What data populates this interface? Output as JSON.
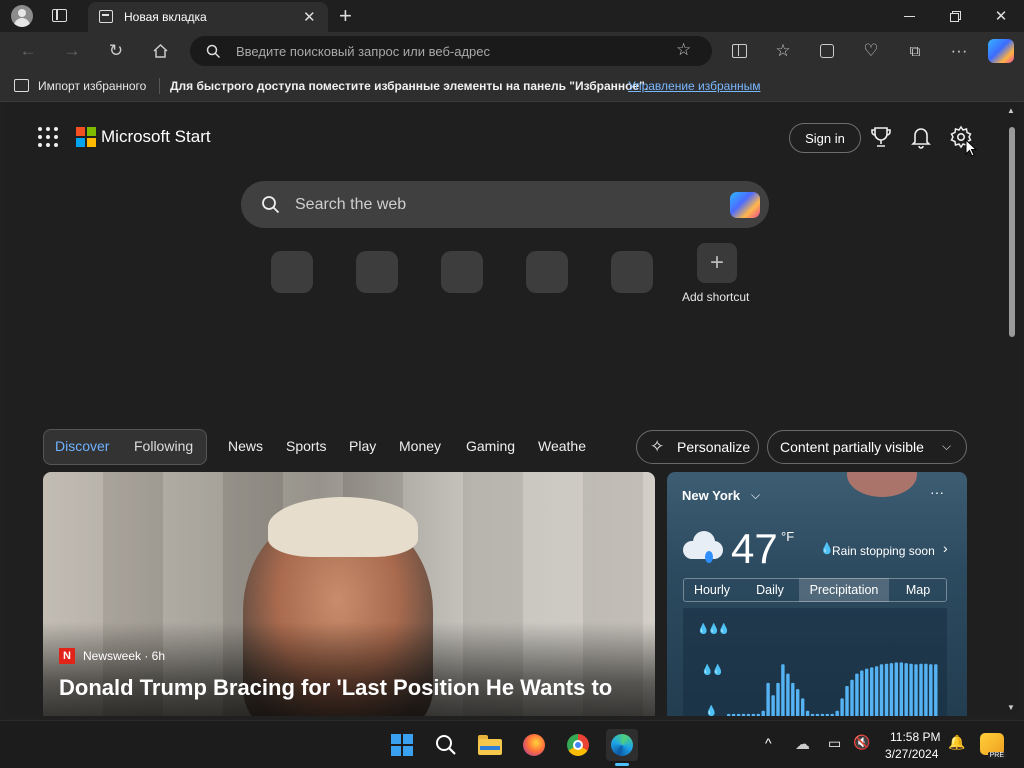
{
  "browser": {
    "tab_title": "Новая вкладка",
    "address_placeholder": "Введите поисковый запрос или веб-адрес",
    "favorites": {
      "import_label": "Импорт избранного",
      "hint_text": "Для быстрого доступа поместите избранные элементы на панель \"Избранное\".",
      "manage_link": "Управление избранным"
    }
  },
  "page": {
    "brand": "Microsoft Start",
    "sign_in": "Sign in",
    "search_placeholder": "Search the web",
    "add_shortcut": "Add shortcut",
    "feed_tabs": [
      "Discover",
      "Following"
    ],
    "nav": [
      "News",
      "Sports",
      "Play",
      "Money",
      "Gaming",
      "Weathe"
    ],
    "personalize": "Personalize",
    "content_visibility": "Content partially visible"
  },
  "news": {
    "source": "Newsweek",
    "age": "6h",
    "source_line": "Newsweek · 6h",
    "headline": "Donald Trump Bracing for 'Last Position He Wants to"
  },
  "weather": {
    "location": "New York",
    "temperature": "47",
    "unit": "°F",
    "summary": "Rain stopping soon",
    "tabs": [
      "Hourly",
      "Daily",
      "Precipitation",
      "Map"
    ],
    "active_tab": "Precipitation",
    "precip_bars": [
      0.05,
      0.05,
      0.05,
      0.05,
      0.05,
      0.05,
      0.05,
      0.1,
      0.55,
      0.35,
      0.55,
      0.85,
      0.7,
      0.55,
      0.45,
      0.3,
      0.1,
      0.05,
      0.05,
      0.05,
      0.05,
      0.05,
      0.1,
      0.3,
      0.5,
      0.6,
      0.7,
      0.75,
      0.78,
      0.8,
      0.82,
      0.85,
      0.86,
      0.87,
      0.88,
      0.88,
      0.87,
      0.86,
      0.85,
      0.86,
      0.86,
      0.85,
      0.85
    ]
  },
  "taskbar": {
    "time": "11:58 PM",
    "date": "3/27/2024"
  },
  "colors": {
    "accent": "#4aa3ff",
    "link": "#7ab8ff",
    "weather_bar": "#55b3f3"
  }
}
